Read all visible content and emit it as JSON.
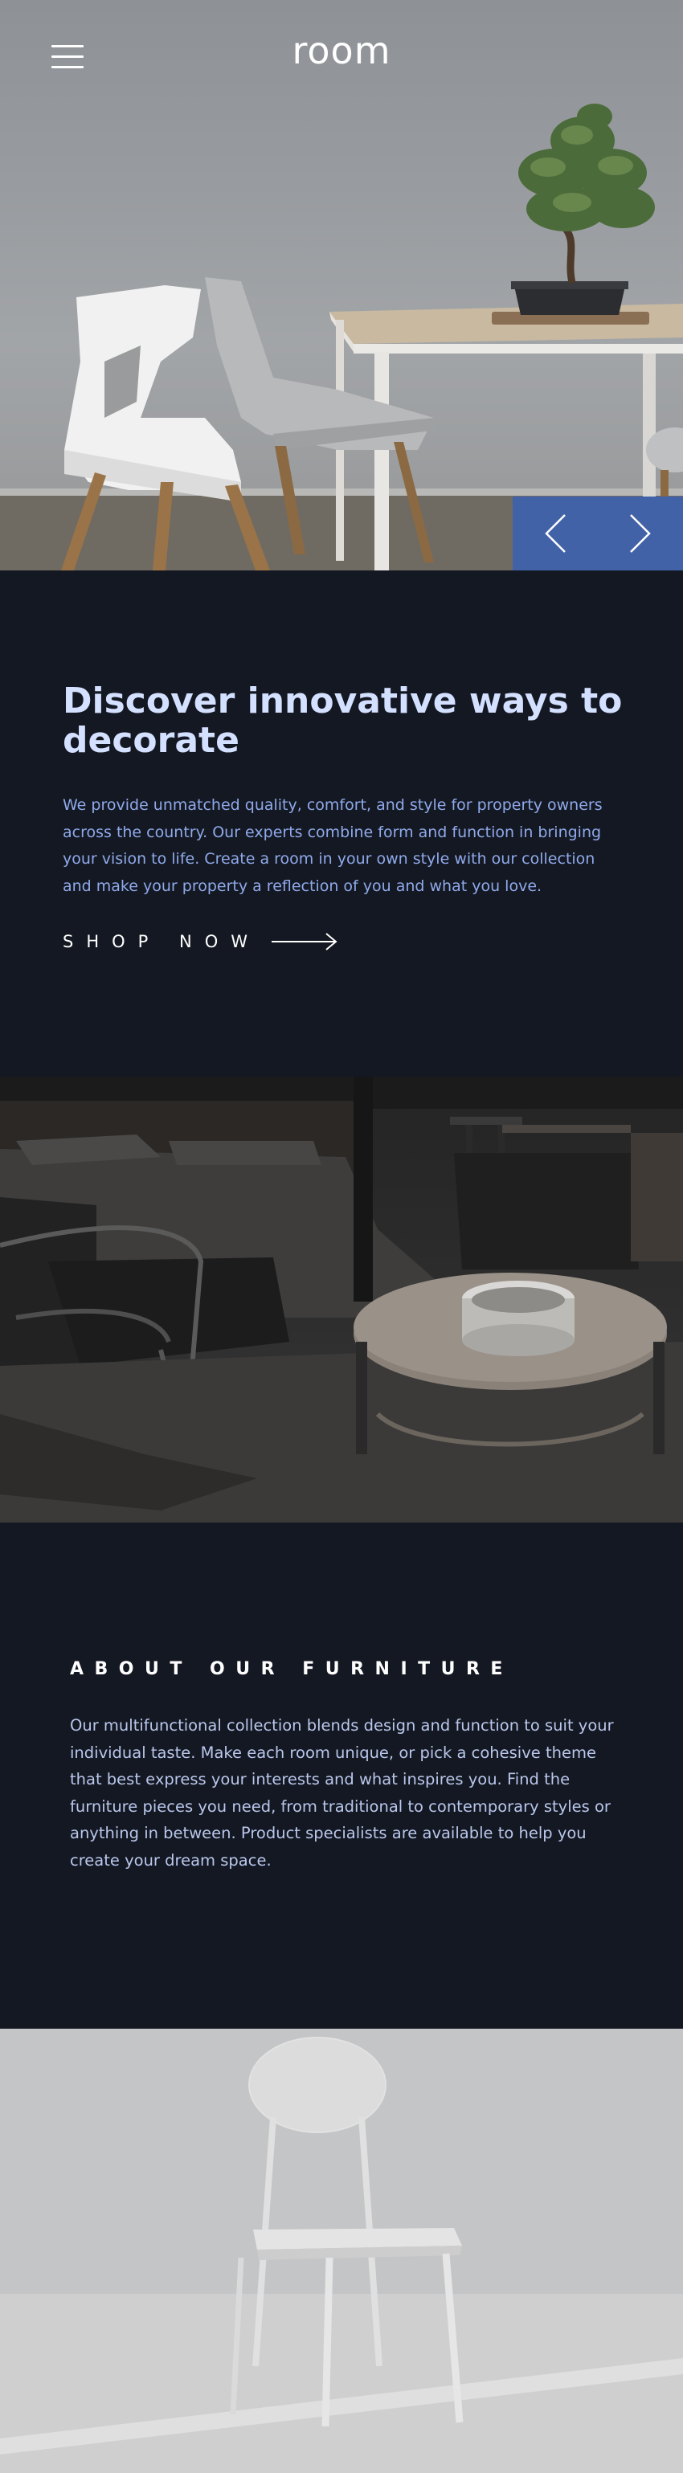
{
  "header": {
    "logo": "room",
    "menu_icon": "hamburger-menu-icon"
  },
  "slider": {
    "prev_icon": "chevron-left-icon",
    "next_icon": "chevron-right-icon",
    "accent_color": "#4262a8"
  },
  "intro": {
    "title": "Discover innovative ways to decorate",
    "text": "We provide unmatched quality, comfort, and style for property owners across the country. Our experts combine form and function in bringing your vision to life. Create a room in your own style with our collection and make your property a reflection of you and what you love.",
    "cta_label": "SHOP NOW",
    "cta_icon": "arrow-right-icon"
  },
  "about": {
    "title": "ABOUT OUR FURNITURE",
    "text": "Our multifunctional collection blends design and function to suit your individual taste. Make each room unique, or pick a cohesive theme that best express your interests and what inspires you. Find the furniture pieces you need, from traditional to contemporary styles or anything in between. Product specialists are available to help you create your dream space."
  },
  "colors": {
    "background_dark": "#141822",
    "title_color": "#d4e0ff",
    "text_color": "#8fa9ea"
  }
}
